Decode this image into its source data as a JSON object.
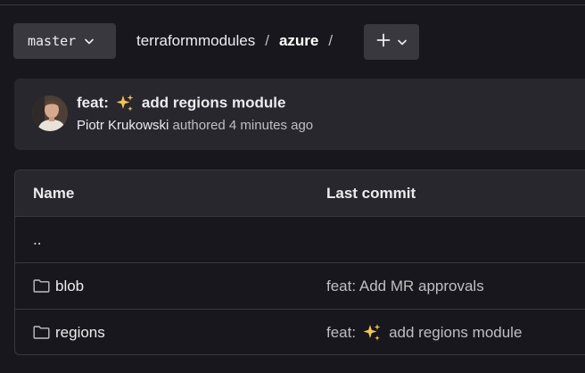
{
  "repo_nav": {
    "branch": "master",
    "breadcrumb": {
      "group": "terraformmodules",
      "separator": "/",
      "current": "azure",
      "trailing_separator": "/"
    },
    "add_button_icon": "plus-icon"
  },
  "latest_commit": {
    "title_prefix": "feat:",
    "title_emoji": "sparkles-icon",
    "title_text": "add regions module",
    "author": "Piotr Krukowski",
    "action": "authored",
    "time": "4 minutes ago"
  },
  "file_table": {
    "headers": {
      "name": "Name",
      "last_commit": "Last commit"
    },
    "rows": [
      {
        "type": "parent",
        "name": "..",
        "commit_prefix": "",
        "commit_emoji": "",
        "commit_text": ""
      },
      {
        "type": "folder",
        "name": "blob",
        "commit_prefix": "feat: Add MR approvals",
        "commit_emoji": "",
        "commit_text": ""
      },
      {
        "type": "folder",
        "name": "regions",
        "commit_prefix": "feat:",
        "commit_emoji": "sparkles-icon",
        "commit_text": "add regions module"
      }
    ]
  },
  "colors": {
    "background": "#18171d",
    "surface": "#28272d",
    "button": "#3a383f",
    "border": "#3a383f",
    "text": "#ececef",
    "muted_text": "#bfbfc3",
    "sparkle": "#f5c84c"
  }
}
